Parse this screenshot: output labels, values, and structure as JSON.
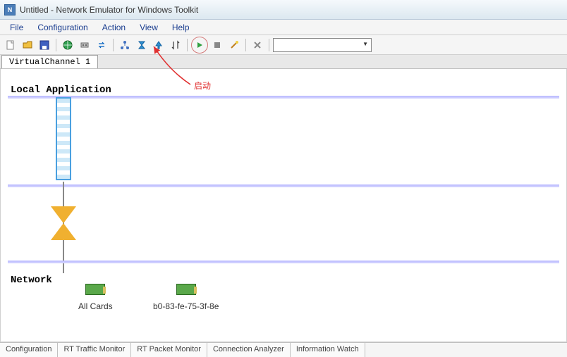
{
  "window": {
    "title": "Untitled - Network Emulator for Windows Toolkit"
  },
  "menu": {
    "file": "File",
    "configuration": "Configuration",
    "action": "Action",
    "view": "View",
    "help": "Help"
  },
  "toolbar": {
    "icons": {
      "new": "new-file-icon",
      "open": "open-folder-icon",
      "save": "save-icon",
      "globe": "globe-icon",
      "recorder": "recorder-icon",
      "swap": "swap-icon",
      "topology": "topology-icon",
      "hourglass": "hourglass-icon",
      "uparrow": "uparrow-icon",
      "sort": "sort-icon",
      "play": "play-icon",
      "stop": "stop-icon",
      "wand": "wand-icon",
      "tools": "tools-icon"
    },
    "combo_value": ""
  },
  "tabs": {
    "virtual_channel": "VirtualChannel 1"
  },
  "canvas": {
    "local_app_label": "Local Application",
    "network_label": "Network",
    "cards": {
      "all": "All Cards",
      "nic": "b0-83-fe-75-3f-8e"
    }
  },
  "annotation": {
    "start_label": "启动"
  },
  "bottom_tabs": {
    "configuration": "Configuration",
    "traffic": "RT Traffic Monitor",
    "packet": "RT Packet Monitor",
    "analyzer": "Connection Analyzer",
    "info": "Information Watch"
  }
}
